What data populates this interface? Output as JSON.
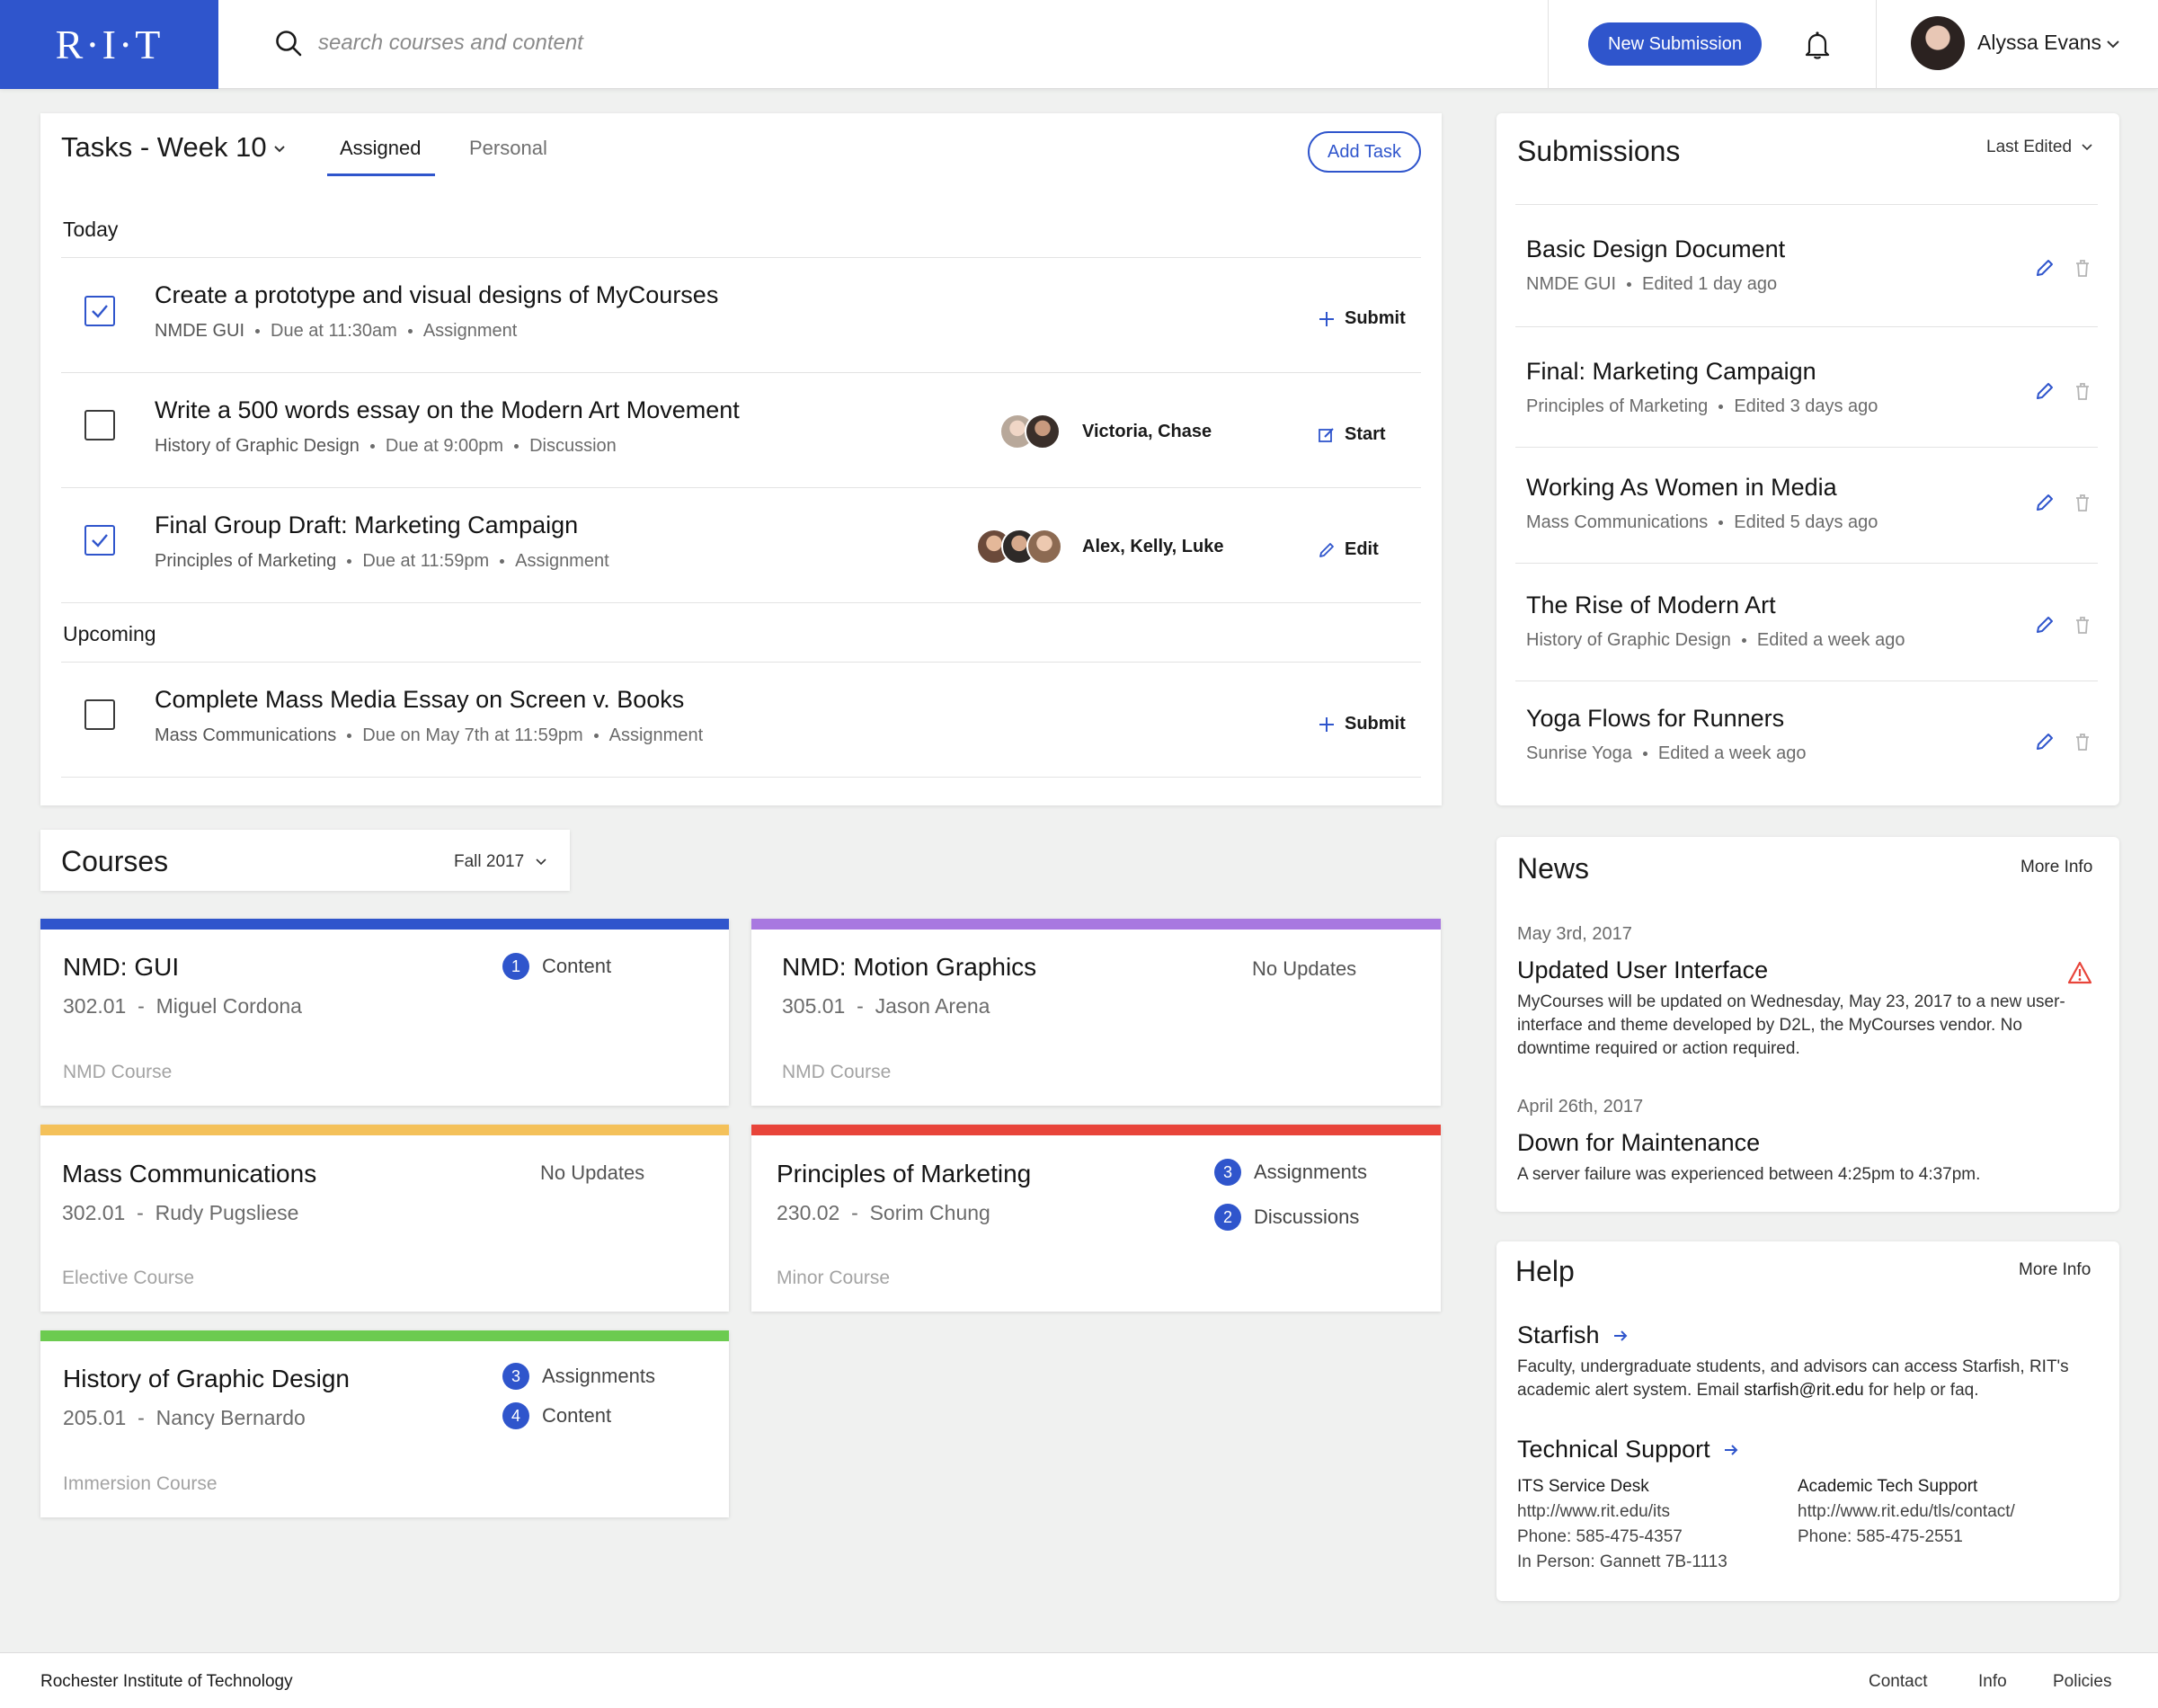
{
  "header": {
    "logo": "R·I·T",
    "search_placeholder": "search courses and content",
    "new_submission": "New Submission",
    "user_name": "Alyssa Evans"
  },
  "tasks": {
    "title": "Tasks - Week 10",
    "tabs": [
      "Assigned",
      "Personal"
    ],
    "add_task": "Add Task",
    "today_label": "Today",
    "upcoming_label": "Upcoming",
    "items": [
      {
        "title": "Create a prototype and visual designs of MyCourses",
        "course": "NMDE GUI",
        "due": "Due at 11:30am",
        "type": "Assignment",
        "checked": true,
        "action": "Submit"
      },
      {
        "title": "Write a 500 words essay on the Modern Art Movement",
        "course": "History of Graphic Design",
        "due": "Due at 9:00pm",
        "type": "Discussion",
        "checked": false,
        "collaborators": "Victoria, Chase",
        "action": "Start"
      },
      {
        "title": "Final Group Draft: Marketing Campaign",
        "course": "Principles of Marketing",
        "due": "Due at 11:59pm",
        "type": "Assignment",
        "checked": true,
        "collaborators": "Alex, Kelly, Luke",
        "action": "Edit"
      },
      {
        "title": "Complete Mass Media Essay on Screen v. Books",
        "course": "Mass Communications",
        "due": "Due on May 7th at 11:59pm",
        "type": "Assignment",
        "checked": false,
        "action": "Submit"
      }
    ]
  },
  "submissions": {
    "title": "Submissions",
    "sort": "Last Edited",
    "items": [
      {
        "title": "Basic Design Document",
        "course": "NMDE GUI",
        "edited": "Edited 1 day ago"
      },
      {
        "title": "Final: Marketing Campaign",
        "course": "Principles of Marketing",
        "edited": "Edited 3 days ago"
      },
      {
        "title": "Working As Women in Media",
        "course": "Mass Communications",
        "edited": "Edited 5 days ago"
      },
      {
        "title": "The Rise of Modern Art",
        "course": "History of Graphic Design",
        "edited": "Edited a week ago"
      },
      {
        "title": "Yoga Flows for Runners",
        "course": "Sunrise Yoga",
        "edited": "Edited a week ago"
      }
    ]
  },
  "news": {
    "title": "News",
    "more_info": "More Info",
    "items": [
      {
        "date": "May 3rd, 2017",
        "headline": "Updated User Interface",
        "body": "MyCourses will be updated on Wednesday, May 23, 2017 to a new user-interface and theme developed by D2L, the MyCourses vendor. No downtime required or action required."
      },
      {
        "date": "April 26th, 2017",
        "headline": "Down for Maintenance",
        "body": "A server failure was experienced between 4:25pm to 4:37pm."
      }
    ]
  },
  "help": {
    "title": "Help",
    "more_info": "More Info",
    "starfish": {
      "title": "Starfish",
      "body_pre": "Faculty, undergraduate students, and advisors can access Starfish, RIT's academic alert system. Email ",
      "email": "starfish@rit.edu",
      "body_post": " for help or faq."
    },
    "tech_support": {
      "title": "Technical Support",
      "its": {
        "title": "ITS Service Desk",
        "url": "http://www.rit.edu/its",
        "phone": "Phone: 585-475-4357",
        "in_person": "In Person: Gannett 7B-1113"
      },
      "ats": {
        "title": "Academic Tech Support",
        "url": "http://www.rit.edu/tls/contact/",
        "phone": "Phone: 585-475-2551"
      }
    }
  },
  "courses": {
    "title": "Courses",
    "term": "Fall 2017",
    "items": [
      {
        "name": "NMD: GUI",
        "section": "302.01",
        "instructor": "Miguel Cordona",
        "type": "NMD Course",
        "color": "#2f55cc",
        "updates": [
          {
            "count": "1",
            "label": "Content"
          }
        ]
      },
      {
        "name": "NMD: Motion Graphics",
        "section": "305.01",
        "instructor": "Jason Arena",
        "type": "NMD Course",
        "color": "#a878e0",
        "no_updates": "No Updates"
      },
      {
        "name": "Mass Communications",
        "section": "302.01",
        "instructor": "Rudy Pugsliese",
        "type": "Elective Course",
        "color": "#f4c15a",
        "no_updates": "No Updates"
      },
      {
        "name": "Principles of Marketing",
        "section": "230.02",
        "instructor": "Sorim Chung",
        "type": "Minor Course",
        "color": "#e8443a",
        "updates": [
          {
            "count": "3",
            "label": "Assignments"
          },
          {
            "count": "2",
            "label": "Discussions"
          }
        ]
      },
      {
        "name": "History of Graphic Design",
        "section": "205.01",
        "instructor": "Nancy Bernardo",
        "type": "Immersion Course",
        "color": "#6ccb50",
        "updates": [
          {
            "count": "3",
            "label": "Assignments"
          },
          {
            "count": "4",
            "label": "Content"
          }
        ]
      }
    ]
  },
  "footer": {
    "name": "Rochester Institute of Technology",
    "links": [
      "Contact",
      "Info",
      "Policies"
    ]
  },
  "colors": {
    "accent": "#2f55cc",
    "warning": "#e8443a"
  }
}
